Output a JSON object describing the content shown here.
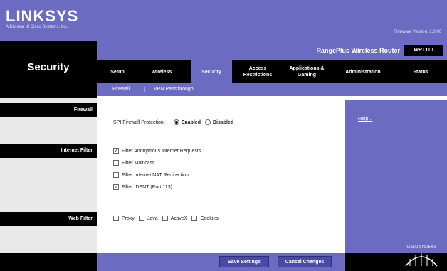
{
  "brand": {
    "logo": "LINKSYS",
    "subtitle": "A Division of Cisco Systems, Inc.",
    "firmware": "Firmware Version: 1.0.00"
  },
  "page": {
    "section_title": "Security",
    "product_name": "RangePlus Wireless Router",
    "model": "WRT110"
  },
  "nav": {
    "tabs": [
      {
        "label": "Setup"
      },
      {
        "label": "Wireless"
      },
      {
        "label": "Security"
      },
      {
        "label": "Access Restrictions"
      },
      {
        "label": "Applications & Gaming"
      },
      {
        "label": "Administration"
      },
      {
        "label": "Status"
      }
    ],
    "subtabs": [
      {
        "label": "Firewall"
      },
      {
        "label": "VPN Passthrough"
      }
    ],
    "separator": "|"
  },
  "sections": {
    "firewall": "Firewall",
    "internet_filter": "Internet Filter",
    "web_filter": "Web Filter"
  },
  "firewall": {
    "label": "SPI Firewall Protection:",
    "enabled_label": "Enabled",
    "disabled_label": "Disabled",
    "selected": "Enabled"
  },
  "internet_filter": {
    "items": [
      {
        "label": "Filter Anonymous Internet Requests",
        "checked": true
      },
      {
        "label": "Filter Multicast",
        "checked": false
      },
      {
        "label": "Filter Internet NAT Redirection",
        "checked": false
      },
      {
        "label": "Filter IDENT (Port 113)",
        "checked": true
      }
    ]
  },
  "web_filter": {
    "items": [
      {
        "label": "Proxy",
        "checked": false
      },
      {
        "label": "Java",
        "checked": false
      },
      {
        "label": "ActiveX",
        "checked": false
      },
      {
        "label": "Cookies",
        "checked": false
      }
    ]
  },
  "help": {
    "label": "Help..."
  },
  "footer": {
    "save": "Save Settings",
    "cancel": "Cancel Changes"
  },
  "cisco": {
    "label": "CISCO SYSTEMS"
  },
  "colors": {
    "purple": "#6b6bc1",
    "black": "#000000",
    "grey": "#e9e9e9"
  }
}
